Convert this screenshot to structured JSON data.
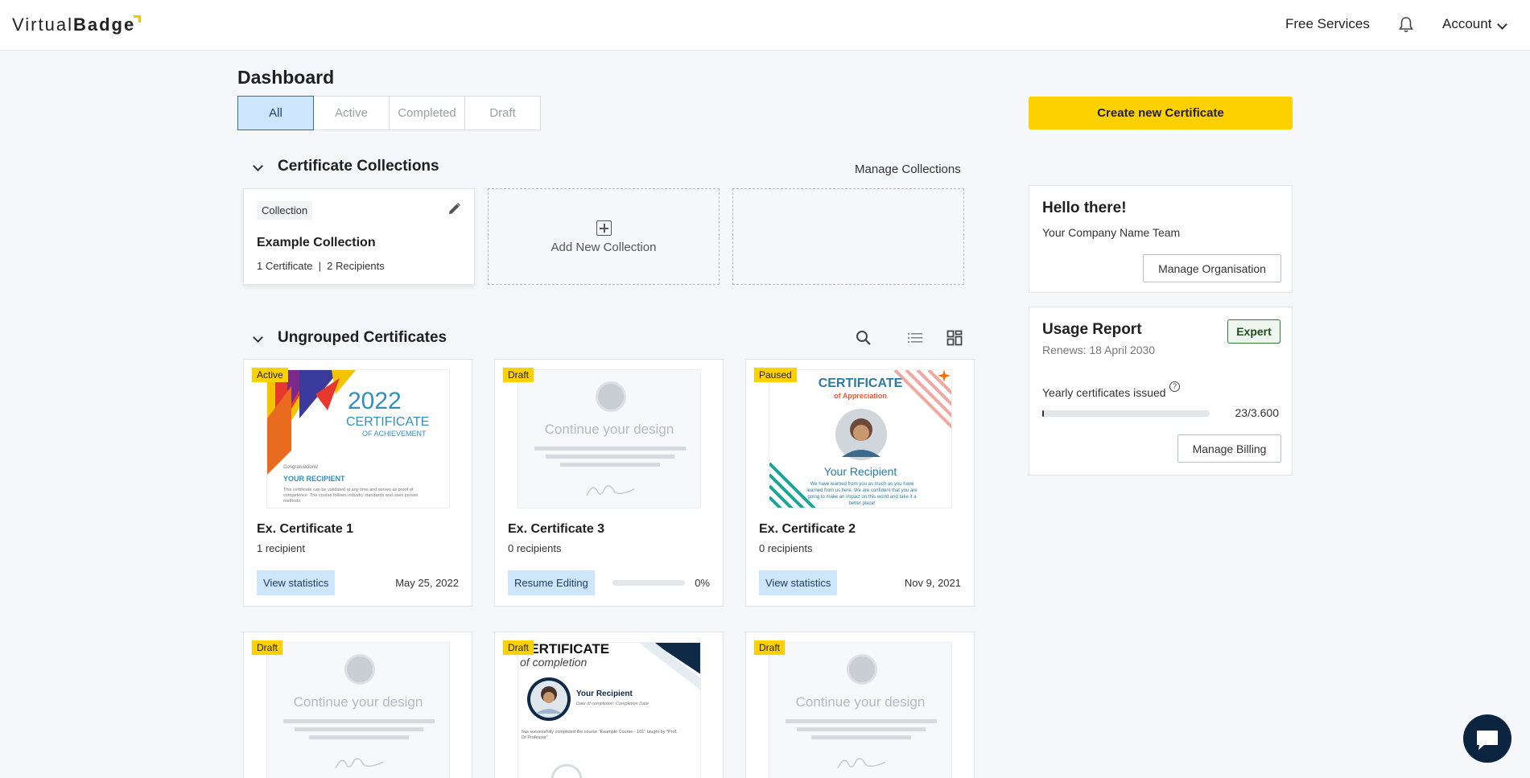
{
  "header": {
    "logo_light": "Virtual",
    "logo_bold": "Badge",
    "free_services": "Free Services",
    "account": "Account"
  },
  "dashboard": {
    "title": "Dashboard",
    "tabs": [
      {
        "label": "All",
        "active": true
      },
      {
        "label": "Active",
        "active": false
      },
      {
        "label": "Completed",
        "active": false
      },
      {
        "label": "Draft",
        "active": false
      }
    ],
    "create_button": "Create new Certificate"
  },
  "collections": {
    "title": "Certificate Collections",
    "manage_link": "Manage Collections",
    "items": [
      {
        "tag": "Collection",
        "name": "Example Collection",
        "meta": "1 Certificate  |  2 Recipients"
      }
    ],
    "add_label": "Add New Collection"
  },
  "ungrouped": {
    "title": "Ungrouped Certificates",
    "certificates": [
      {
        "status": "Active",
        "name": "Ex. Certificate 1",
        "recipients": "1 recipient",
        "action": "View statistics",
        "date": "May 25, 2022"
      },
      {
        "status": "Draft",
        "name": "Ex. Certificate 3",
        "recipients": "0 recipients",
        "action": "Resume Editing",
        "progress_text": "0%",
        "progress": 0
      },
      {
        "status": "Paused",
        "name": "Ex. Certificate 2",
        "recipients": "0 recipients",
        "action": "View statistics",
        "date": "Nov 9, 2021"
      },
      {
        "status": "Draft"
      },
      {
        "status": "Draft"
      },
      {
        "status": "Draft"
      }
    ],
    "placeholder_text": "Continue your design",
    "thumb1": {
      "year": "2022",
      "title": "CERTIFICATE",
      "sub": "OF ACHIEVEMENT",
      "congrats": "Congratulations!",
      "recipient": "YOUR RECIPIENT",
      "body": "This certificate can be validated at any time and serves as proof of competence. The course follows industry standards and uses proven methods."
    },
    "thumb2": {
      "title": "CERTIFICATE",
      "sub": "of Appreciation",
      "recipient": "Your Recipient",
      "body": "We have learned from you as much as you have learned from us here. We are confident that you are going to make an impact on this world and take it a better place!"
    },
    "thumb3": {
      "title": "CERTIFICATE",
      "sub": "of completion",
      "recipient": "Your Recipient",
      "date_line": "Date of completion: Completion Date",
      "body": "has successfully completed the course \"Example Course - 101\" taught by \"Prof. Dr Professor\""
    }
  },
  "hello_panel": {
    "title": "Hello there!",
    "team": "Your Company Name Team",
    "button": "Manage Organisation"
  },
  "usage_panel": {
    "title": "Usage Report",
    "renews": "Renews: 18 April 2030",
    "plan_badge": "Expert",
    "yearly_label": "Yearly certificates issued",
    "help_icon": "?",
    "count": "23/3.600",
    "usage_fraction": 0.0064,
    "button": "Manage Billing"
  },
  "colors": {
    "accent_yellow": "#fdd000",
    "active_blue": "#cde6fb",
    "chat_navy": "#0b2540"
  }
}
